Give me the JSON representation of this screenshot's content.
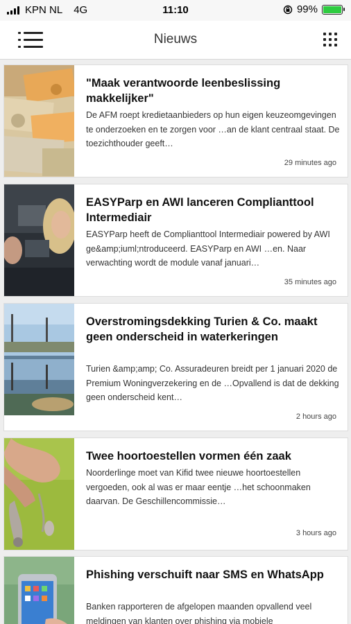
{
  "status_bar": {
    "carrier": "KPN NL",
    "network": "4G",
    "time": "11:10",
    "battery": "99%"
  },
  "header": {
    "title": "Nieuws"
  },
  "articles": [
    {
      "title": "\"Maak verantwoorde leenbeslissing makkelijker\"",
      "excerpt": "De AFM roept kredietaanbieders op hun eigen keuzeomgevingen te onderzoeken en te zorgen voor …an de klant centraal staat. De toezichthouder geeft…",
      "time": "29 minutes ago"
    },
    {
      "title": "EASYParp en AWI lanceren Complianttool Intermediair",
      "excerpt": "EASYParp heeft de Complianttool Intermediair powered by AWI ge&amp;iuml;ntroduceerd. EASYParp en AWI …en. Naar verwachting wordt de module vanaf januari…",
      "time": "35 minutes ago"
    },
    {
      "title": "Overstromingsdekking Turien & Co. maakt geen onderscheid in waterkeringen",
      "excerpt": "Turien &amp;amp; Co. Assuradeuren breidt per 1 januari 2020 de Premium Woningverzekering en de …Opvallend is dat de dekking geen onderscheid kent…",
      "time": "2 hours ago"
    },
    {
      "title": "Twee hoortoestellen vormen één zaak",
      "excerpt": "Noorderlinge moet van Kifid twee nieuwe hoortoestellen vergoeden, ook al was er maar eentje …het schoonmaken daarvan. De Geschillencommissie…",
      "time": "3 hours ago"
    },
    {
      "title": "Phishing verschuift naar SMS en WhatsApp",
      "excerpt": "Banken rapporteren de afgelopen maanden opvallend veel meldingen van klanten over phishing via mobiele",
      "time": ""
    }
  ],
  "colors": {
    "background": "#eeeeee",
    "card": "#ffffff",
    "battery": "#2ecc40"
  }
}
